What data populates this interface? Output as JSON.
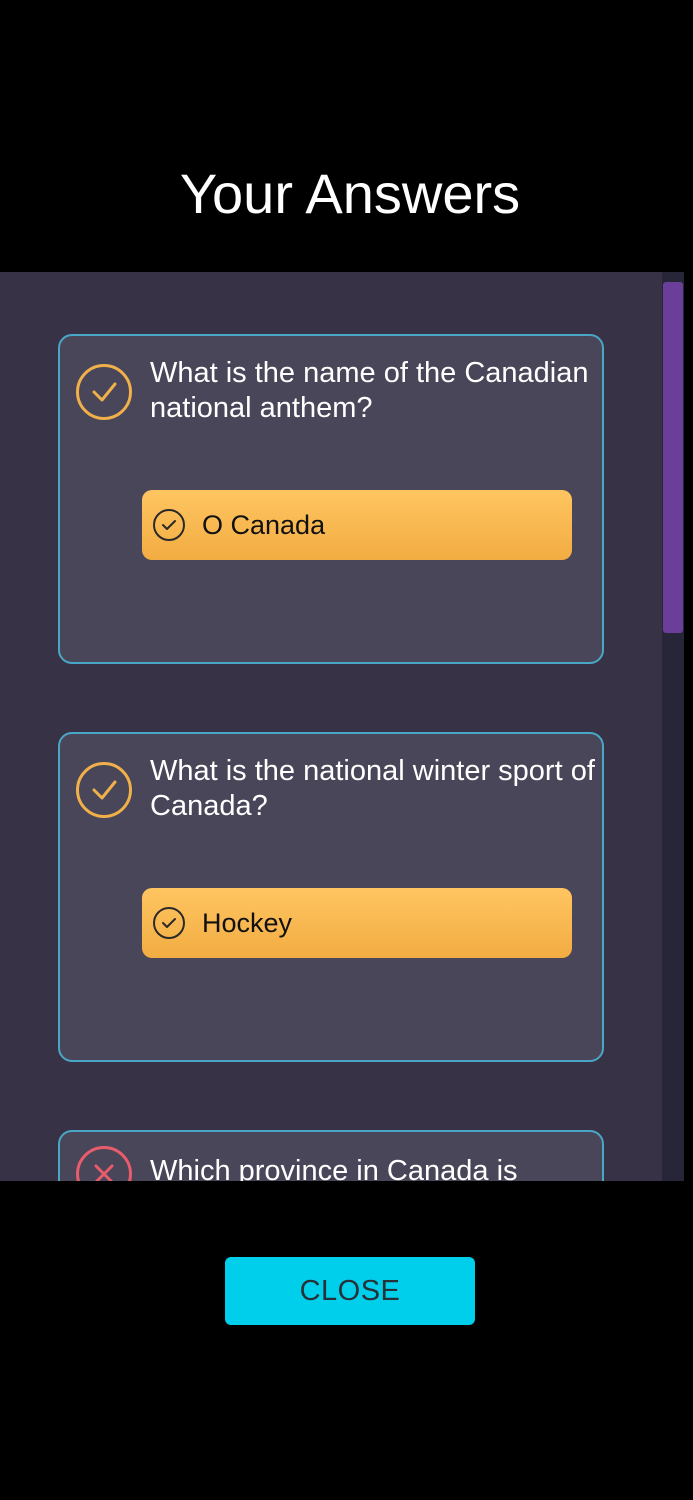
{
  "header": {
    "title": "Your Answers"
  },
  "answers": [
    {
      "question": "What is the name of the Canadian national anthem?",
      "status": "correct",
      "answer": "O Canada"
    },
    {
      "question": "What is the national winter sport of Canada?",
      "status": "correct",
      "answer": "Hockey"
    },
    {
      "question": "Which province in Canada is",
      "status": "incorrect"
    }
  ],
  "footer": {
    "close_label": "CLOSE"
  },
  "colors": {
    "accent_answer": "#f2ac42",
    "card_border": "#4aa6c6",
    "close_button": "#00cfec",
    "scroll_thumb": "#6b3f99",
    "incorrect": "#e85c6c"
  }
}
